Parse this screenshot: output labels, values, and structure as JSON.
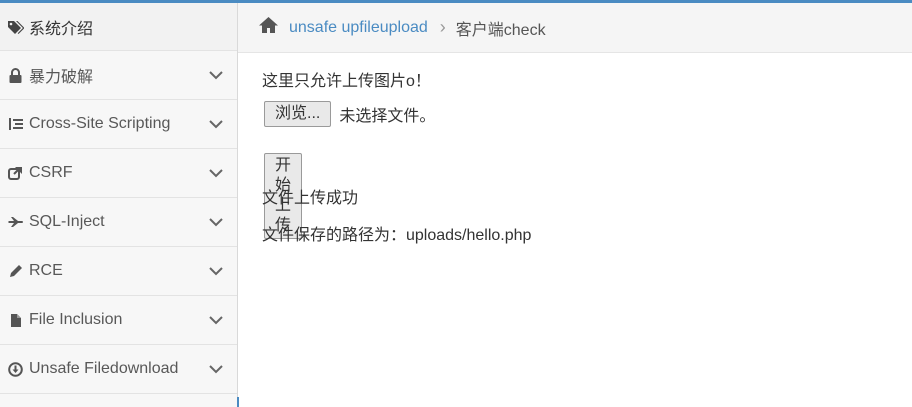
{
  "sidebar": {
    "items": [
      {
        "label": "系统介绍",
        "icon": "tags-icon"
      },
      {
        "label": "暴力破解",
        "icon": "lock-icon"
      },
      {
        "label": "Cross-Site Scripting",
        "icon": "list-tree-icon"
      },
      {
        "label": "CSRF",
        "icon": "share-external-icon"
      },
      {
        "label": "SQL-Inject",
        "icon": "plane-icon"
      },
      {
        "label": "RCE",
        "icon": "pencil-icon"
      },
      {
        "label": "File Inclusion",
        "icon": "file-icon"
      },
      {
        "label": "Unsafe Filedownload",
        "icon": "download-circle-icon"
      }
    ]
  },
  "breadcrumb": {
    "home_icon": "home-icon",
    "section": "unsafe upfileupload",
    "separator": "›",
    "current": "客户端check"
  },
  "main": {
    "notice": "这里只允许上传图片o！",
    "browse_label": "浏览...",
    "file_status": "未选择文件。",
    "upload_label": "开始上传",
    "result": "文件上传成功",
    "path": "文件保存的路径为：uploads/hello.php"
  },
  "colors": {
    "accent": "#4a8bc2",
    "sidebar_bg": "#f7f7f7",
    "breadcrumb_bg": "#f5f5f5"
  }
}
